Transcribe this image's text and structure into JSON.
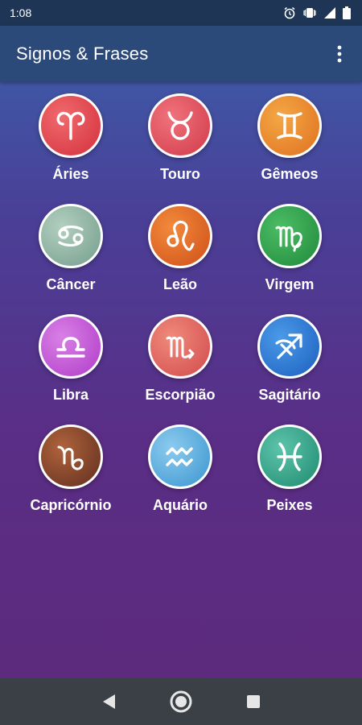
{
  "status_bar": {
    "time": "1:08",
    "icons": [
      "alarm-icon",
      "vibrate-icon",
      "signal-icon",
      "battery-icon"
    ]
  },
  "app_bar": {
    "title": "Signos & Frases",
    "menu_icon": "more-vert-icon"
  },
  "signs": [
    {
      "label": "Áries",
      "icon": "aries-icon",
      "color": "#e0454c"
    },
    {
      "label": "Touro",
      "icon": "taurus-icon",
      "color": "#e8505c"
    },
    {
      "label": "Gêmeos",
      "icon": "gemini-icon",
      "color": "#ea8a2c"
    },
    {
      "label": "Câncer",
      "icon": "cancer-icon",
      "color": "#8fb4a2"
    },
    {
      "label": "Leão",
      "icon": "leo-icon",
      "color": "#e46a24"
    },
    {
      "label": "Virgem",
      "icon": "virgo-icon",
      "color": "#2fa04c"
    },
    {
      "label": "Libra",
      "icon": "libra-icon",
      "color": "#c556d8"
    },
    {
      "label": "Escorpião",
      "icon": "scorpio-icon",
      "color": "#e2645e"
    },
    {
      "label": "Sagitário",
      "icon": "sagittarius-icon",
      "color": "#2e7fd6"
    },
    {
      "label": "Capricórnio",
      "icon": "capricorn-icon",
      "color": "#8a4a2c"
    },
    {
      "label": "Aquário",
      "icon": "aquarius-icon",
      "color": "#5fb2e0"
    },
    {
      "label": "Peixes",
      "icon": "pisces-icon",
      "color": "#34a88e"
    }
  ],
  "nav_bar": {
    "back_icon": "back-triangle-icon",
    "home_icon": "home-circle-icon",
    "recents_icon": "recents-square-icon"
  }
}
